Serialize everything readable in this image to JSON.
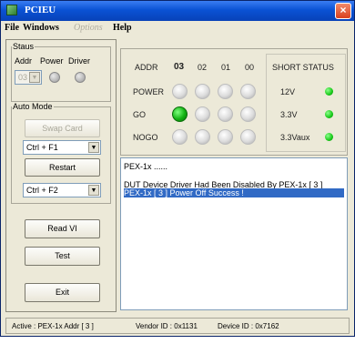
{
  "window": {
    "title": "PCIEU",
    "close_icon": "×"
  },
  "menubar": {
    "items": [
      "File",
      "Windows",
      "Options",
      "Help"
    ]
  },
  "left": {
    "status_group": {
      "legend": "Staus",
      "addr_label": "Addr",
      "power_label": "Power",
      "driver_label": "Driver",
      "addr_value": "03"
    },
    "auto_mode": {
      "legend": "Auto Mode",
      "swap_card": "Swap Card",
      "swap_key": "Ctrl + F1",
      "restart": "Restart",
      "restart_key": "Ctrl + F2"
    },
    "read_vi": "Read VI",
    "test": "Test",
    "exit": "Exit"
  },
  "slots": {
    "addr_label": "ADDR",
    "headers": [
      "03",
      "02",
      "01",
      "00"
    ],
    "rows": [
      {
        "label": "POWER",
        "states": [
          false,
          false,
          false,
          false
        ]
      },
      {
        "label": "GO",
        "states": [
          true,
          false,
          false,
          false
        ]
      },
      {
        "label": "NOGO",
        "states": [
          false,
          false,
          false,
          false
        ]
      }
    ]
  },
  "short_status": {
    "title": "SHORT STATUS",
    "items": [
      {
        "label": "12V",
        "color": "#18c918"
      },
      {
        "label": "3.3V",
        "color": "#18c918"
      },
      {
        "label": "3.3Vaux",
        "color": "#18c918"
      }
    ]
  },
  "log": {
    "lines": [
      "PEX-1x ......",
      "",
      "DUT Device Driver Had Been Disabled By PEX-1x [ 3 ]",
      "PEX-1x [ 3 ] Power Off Success !"
    ],
    "selected_index": 3
  },
  "statusbar": {
    "active": "Active : PEX-1x Addr [ 3 ]",
    "vendor": "Vendor ID : 0x1131",
    "device": "Device ID : 0x7162"
  }
}
